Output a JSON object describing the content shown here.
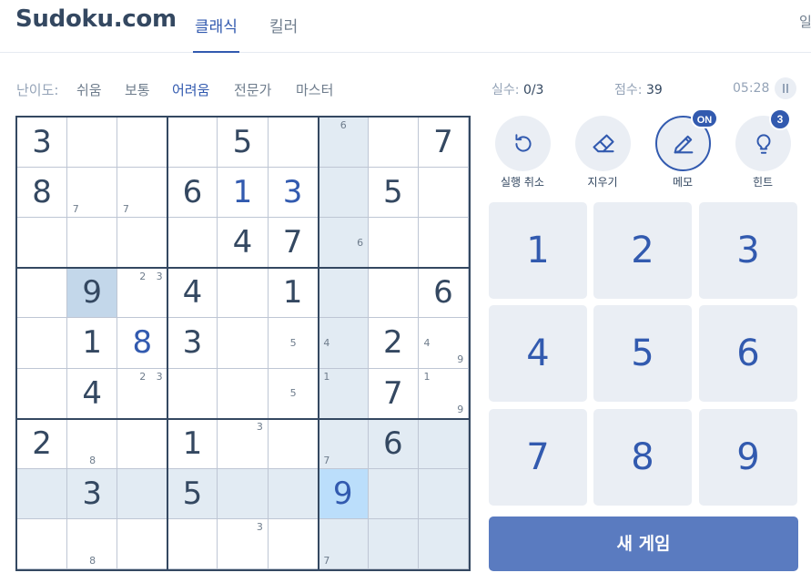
{
  "header": {
    "logo": "Sudoku.com",
    "tabs": [
      {
        "label": "클래식",
        "active": true
      },
      {
        "label": "킬러",
        "active": false
      }
    ],
    "extra": "일"
  },
  "difficulty": {
    "label": "난이도:",
    "items": [
      "쉬움",
      "보통",
      "어려움",
      "전문가",
      "마스터"
    ],
    "active_index": 2
  },
  "stats": {
    "mistakes_label": "실수:",
    "mistakes_value": "0/3",
    "score_label": "점수:",
    "score_value": "39",
    "timer": "05:28"
  },
  "tools": [
    {
      "label": "실행 취소",
      "icon": "undo-icon"
    },
    {
      "label": "지우기",
      "icon": "eraser-icon"
    },
    {
      "label": "메모",
      "icon": "pencil-icon",
      "badge": "ON"
    },
    {
      "label": "힌트",
      "icon": "lightbulb-icon",
      "badge": "3"
    }
  ],
  "numpad": [
    "1",
    "2",
    "3",
    "4",
    "5",
    "6",
    "7",
    "8",
    "9"
  ],
  "new_game_label": "새 게임",
  "board": {
    "selected": [
      7,
      6
    ],
    "rows": [
      [
        {
          "v": "3",
          "g": 1
        },
        {},
        {},
        {},
        {
          "v": "5",
          "g": 1
        },
        {},
        {
          "n": {
            "2": "6"
          }
        },
        {},
        {
          "v": "7",
          "g": 1
        }
      ],
      [
        {
          "v": "8",
          "g": 1
        },
        {
          "n": {
            "7": "7"
          }
        },
        {
          "n": {
            "7": "7"
          }
        },
        {
          "v": "6",
          "g": 1
        },
        {
          "v": "1",
          "g": 0
        },
        {
          "v": "3",
          "g": 0
        },
        {},
        {
          "v": "5",
          "g": 1
        },
        {}
      ],
      [
        {},
        {},
        {},
        {},
        {
          "v": "4",
          "g": 1
        },
        {
          "v": "7",
          "g": 1
        },
        {
          "n": {
            "6": "6"
          }
        },
        {},
        {}
      ],
      [
        {},
        {
          "v": "9",
          "g": 1
        },
        {
          "n": {
            "2": "2",
            "3": "3"
          }
        },
        {
          "v": "4",
          "g": 1
        },
        {},
        {
          "v": "1",
          "g": 1
        },
        {},
        {},
        {
          "v": "6",
          "g": 1
        }
      ],
      [
        {},
        {
          "v": "1",
          "g": 1
        },
        {
          "v": "8",
          "g": 0
        },
        {
          "v": "3",
          "g": 1
        },
        {},
        {
          "n": {
            "5": "5"
          }
        },
        {
          "n": {
            "4": "4"
          }
        },
        {
          "v": "2",
          "g": 1
        },
        {
          "n": {
            "4": "4",
            "9": "9"
          }
        }
      ],
      [
        {},
        {
          "v": "4",
          "g": 1
        },
        {
          "n": {
            "2": "2",
            "3": "3"
          }
        },
        {},
        {},
        {
          "n": {
            "5": "5"
          }
        },
        {
          "n": {
            "1": "1"
          }
        },
        {
          "v": "7",
          "g": 1
        },
        {
          "n": {
            "1": "1",
            "9": "9"
          }
        }
      ],
      [
        {
          "v": "2",
          "g": 1
        },
        {
          "n": {
            "8": "8"
          }
        },
        {},
        {
          "v": "1",
          "g": 1
        },
        {
          "n": {
            "3": "3"
          }
        },
        {},
        {
          "n": {
            "7": "7"
          }
        },
        {
          "v": "6",
          "g": 1
        },
        {}
      ],
      [
        {},
        {
          "v": "3",
          "g": 1
        },
        {},
        {
          "v": "5",
          "g": 1
        },
        {},
        {},
        {
          "v": "9",
          "g": 0
        },
        {},
        {}
      ],
      [
        {},
        {
          "n": {
            "8": "8"
          }
        },
        {},
        {},
        {
          "n": {
            "3": "3"
          }
        },
        {},
        {
          "n": {
            "7": "7"
          }
        },
        {},
        {}
      ]
    ]
  }
}
